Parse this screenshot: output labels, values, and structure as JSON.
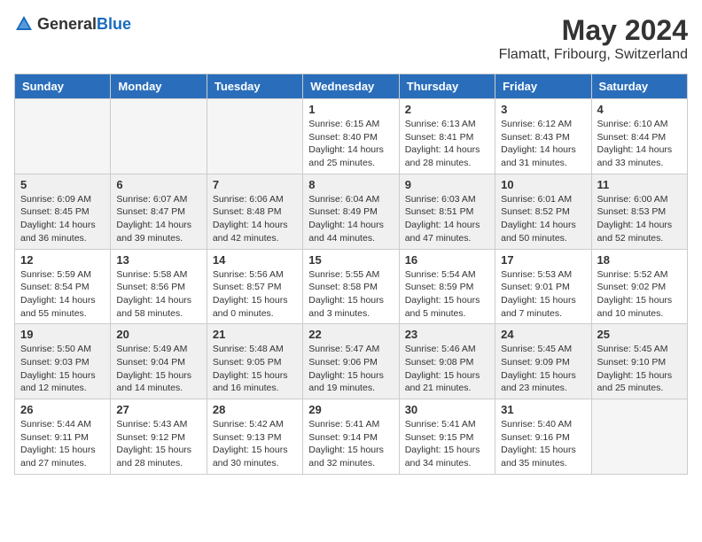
{
  "logo": {
    "general": "General",
    "blue": "Blue"
  },
  "title": "May 2024",
  "subtitle": "Flamatt, Fribourg, Switzerland",
  "weekdays": [
    "Sunday",
    "Monday",
    "Tuesday",
    "Wednesday",
    "Thursday",
    "Friday",
    "Saturday"
  ],
  "weeks": [
    [
      {
        "day": "",
        "info": ""
      },
      {
        "day": "",
        "info": ""
      },
      {
        "day": "",
        "info": ""
      },
      {
        "day": "1",
        "info": "Sunrise: 6:15 AM\nSunset: 8:40 PM\nDaylight: 14 hours\nand 25 minutes."
      },
      {
        "day": "2",
        "info": "Sunrise: 6:13 AM\nSunset: 8:41 PM\nDaylight: 14 hours\nand 28 minutes."
      },
      {
        "day": "3",
        "info": "Sunrise: 6:12 AM\nSunset: 8:43 PM\nDaylight: 14 hours\nand 31 minutes."
      },
      {
        "day": "4",
        "info": "Sunrise: 6:10 AM\nSunset: 8:44 PM\nDaylight: 14 hours\nand 33 minutes."
      }
    ],
    [
      {
        "day": "5",
        "info": "Sunrise: 6:09 AM\nSunset: 8:45 PM\nDaylight: 14 hours\nand 36 minutes."
      },
      {
        "day": "6",
        "info": "Sunrise: 6:07 AM\nSunset: 8:47 PM\nDaylight: 14 hours\nand 39 minutes."
      },
      {
        "day": "7",
        "info": "Sunrise: 6:06 AM\nSunset: 8:48 PM\nDaylight: 14 hours\nand 42 minutes."
      },
      {
        "day": "8",
        "info": "Sunrise: 6:04 AM\nSunset: 8:49 PM\nDaylight: 14 hours\nand 44 minutes."
      },
      {
        "day": "9",
        "info": "Sunrise: 6:03 AM\nSunset: 8:51 PM\nDaylight: 14 hours\nand 47 minutes."
      },
      {
        "day": "10",
        "info": "Sunrise: 6:01 AM\nSunset: 8:52 PM\nDaylight: 14 hours\nand 50 minutes."
      },
      {
        "day": "11",
        "info": "Sunrise: 6:00 AM\nSunset: 8:53 PM\nDaylight: 14 hours\nand 52 minutes."
      }
    ],
    [
      {
        "day": "12",
        "info": "Sunrise: 5:59 AM\nSunset: 8:54 PM\nDaylight: 14 hours\nand 55 minutes."
      },
      {
        "day": "13",
        "info": "Sunrise: 5:58 AM\nSunset: 8:56 PM\nDaylight: 14 hours\nand 58 minutes."
      },
      {
        "day": "14",
        "info": "Sunrise: 5:56 AM\nSunset: 8:57 PM\nDaylight: 15 hours\nand 0 minutes."
      },
      {
        "day": "15",
        "info": "Sunrise: 5:55 AM\nSunset: 8:58 PM\nDaylight: 15 hours\nand 3 minutes."
      },
      {
        "day": "16",
        "info": "Sunrise: 5:54 AM\nSunset: 8:59 PM\nDaylight: 15 hours\nand 5 minutes."
      },
      {
        "day": "17",
        "info": "Sunrise: 5:53 AM\nSunset: 9:01 PM\nDaylight: 15 hours\nand 7 minutes."
      },
      {
        "day": "18",
        "info": "Sunrise: 5:52 AM\nSunset: 9:02 PM\nDaylight: 15 hours\nand 10 minutes."
      }
    ],
    [
      {
        "day": "19",
        "info": "Sunrise: 5:50 AM\nSunset: 9:03 PM\nDaylight: 15 hours\nand 12 minutes."
      },
      {
        "day": "20",
        "info": "Sunrise: 5:49 AM\nSunset: 9:04 PM\nDaylight: 15 hours\nand 14 minutes."
      },
      {
        "day": "21",
        "info": "Sunrise: 5:48 AM\nSunset: 9:05 PM\nDaylight: 15 hours\nand 16 minutes."
      },
      {
        "day": "22",
        "info": "Sunrise: 5:47 AM\nSunset: 9:06 PM\nDaylight: 15 hours\nand 19 minutes."
      },
      {
        "day": "23",
        "info": "Sunrise: 5:46 AM\nSunset: 9:08 PM\nDaylight: 15 hours\nand 21 minutes."
      },
      {
        "day": "24",
        "info": "Sunrise: 5:45 AM\nSunset: 9:09 PM\nDaylight: 15 hours\nand 23 minutes."
      },
      {
        "day": "25",
        "info": "Sunrise: 5:45 AM\nSunset: 9:10 PM\nDaylight: 15 hours\nand 25 minutes."
      }
    ],
    [
      {
        "day": "26",
        "info": "Sunrise: 5:44 AM\nSunset: 9:11 PM\nDaylight: 15 hours\nand 27 minutes."
      },
      {
        "day": "27",
        "info": "Sunrise: 5:43 AM\nSunset: 9:12 PM\nDaylight: 15 hours\nand 28 minutes."
      },
      {
        "day": "28",
        "info": "Sunrise: 5:42 AM\nSunset: 9:13 PM\nDaylight: 15 hours\nand 30 minutes."
      },
      {
        "day": "29",
        "info": "Sunrise: 5:41 AM\nSunset: 9:14 PM\nDaylight: 15 hours\nand 32 minutes."
      },
      {
        "day": "30",
        "info": "Sunrise: 5:41 AM\nSunset: 9:15 PM\nDaylight: 15 hours\nand 34 minutes."
      },
      {
        "day": "31",
        "info": "Sunrise: 5:40 AM\nSunset: 9:16 PM\nDaylight: 15 hours\nand 35 minutes."
      },
      {
        "day": "",
        "info": ""
      }
    ]
  ]
}
